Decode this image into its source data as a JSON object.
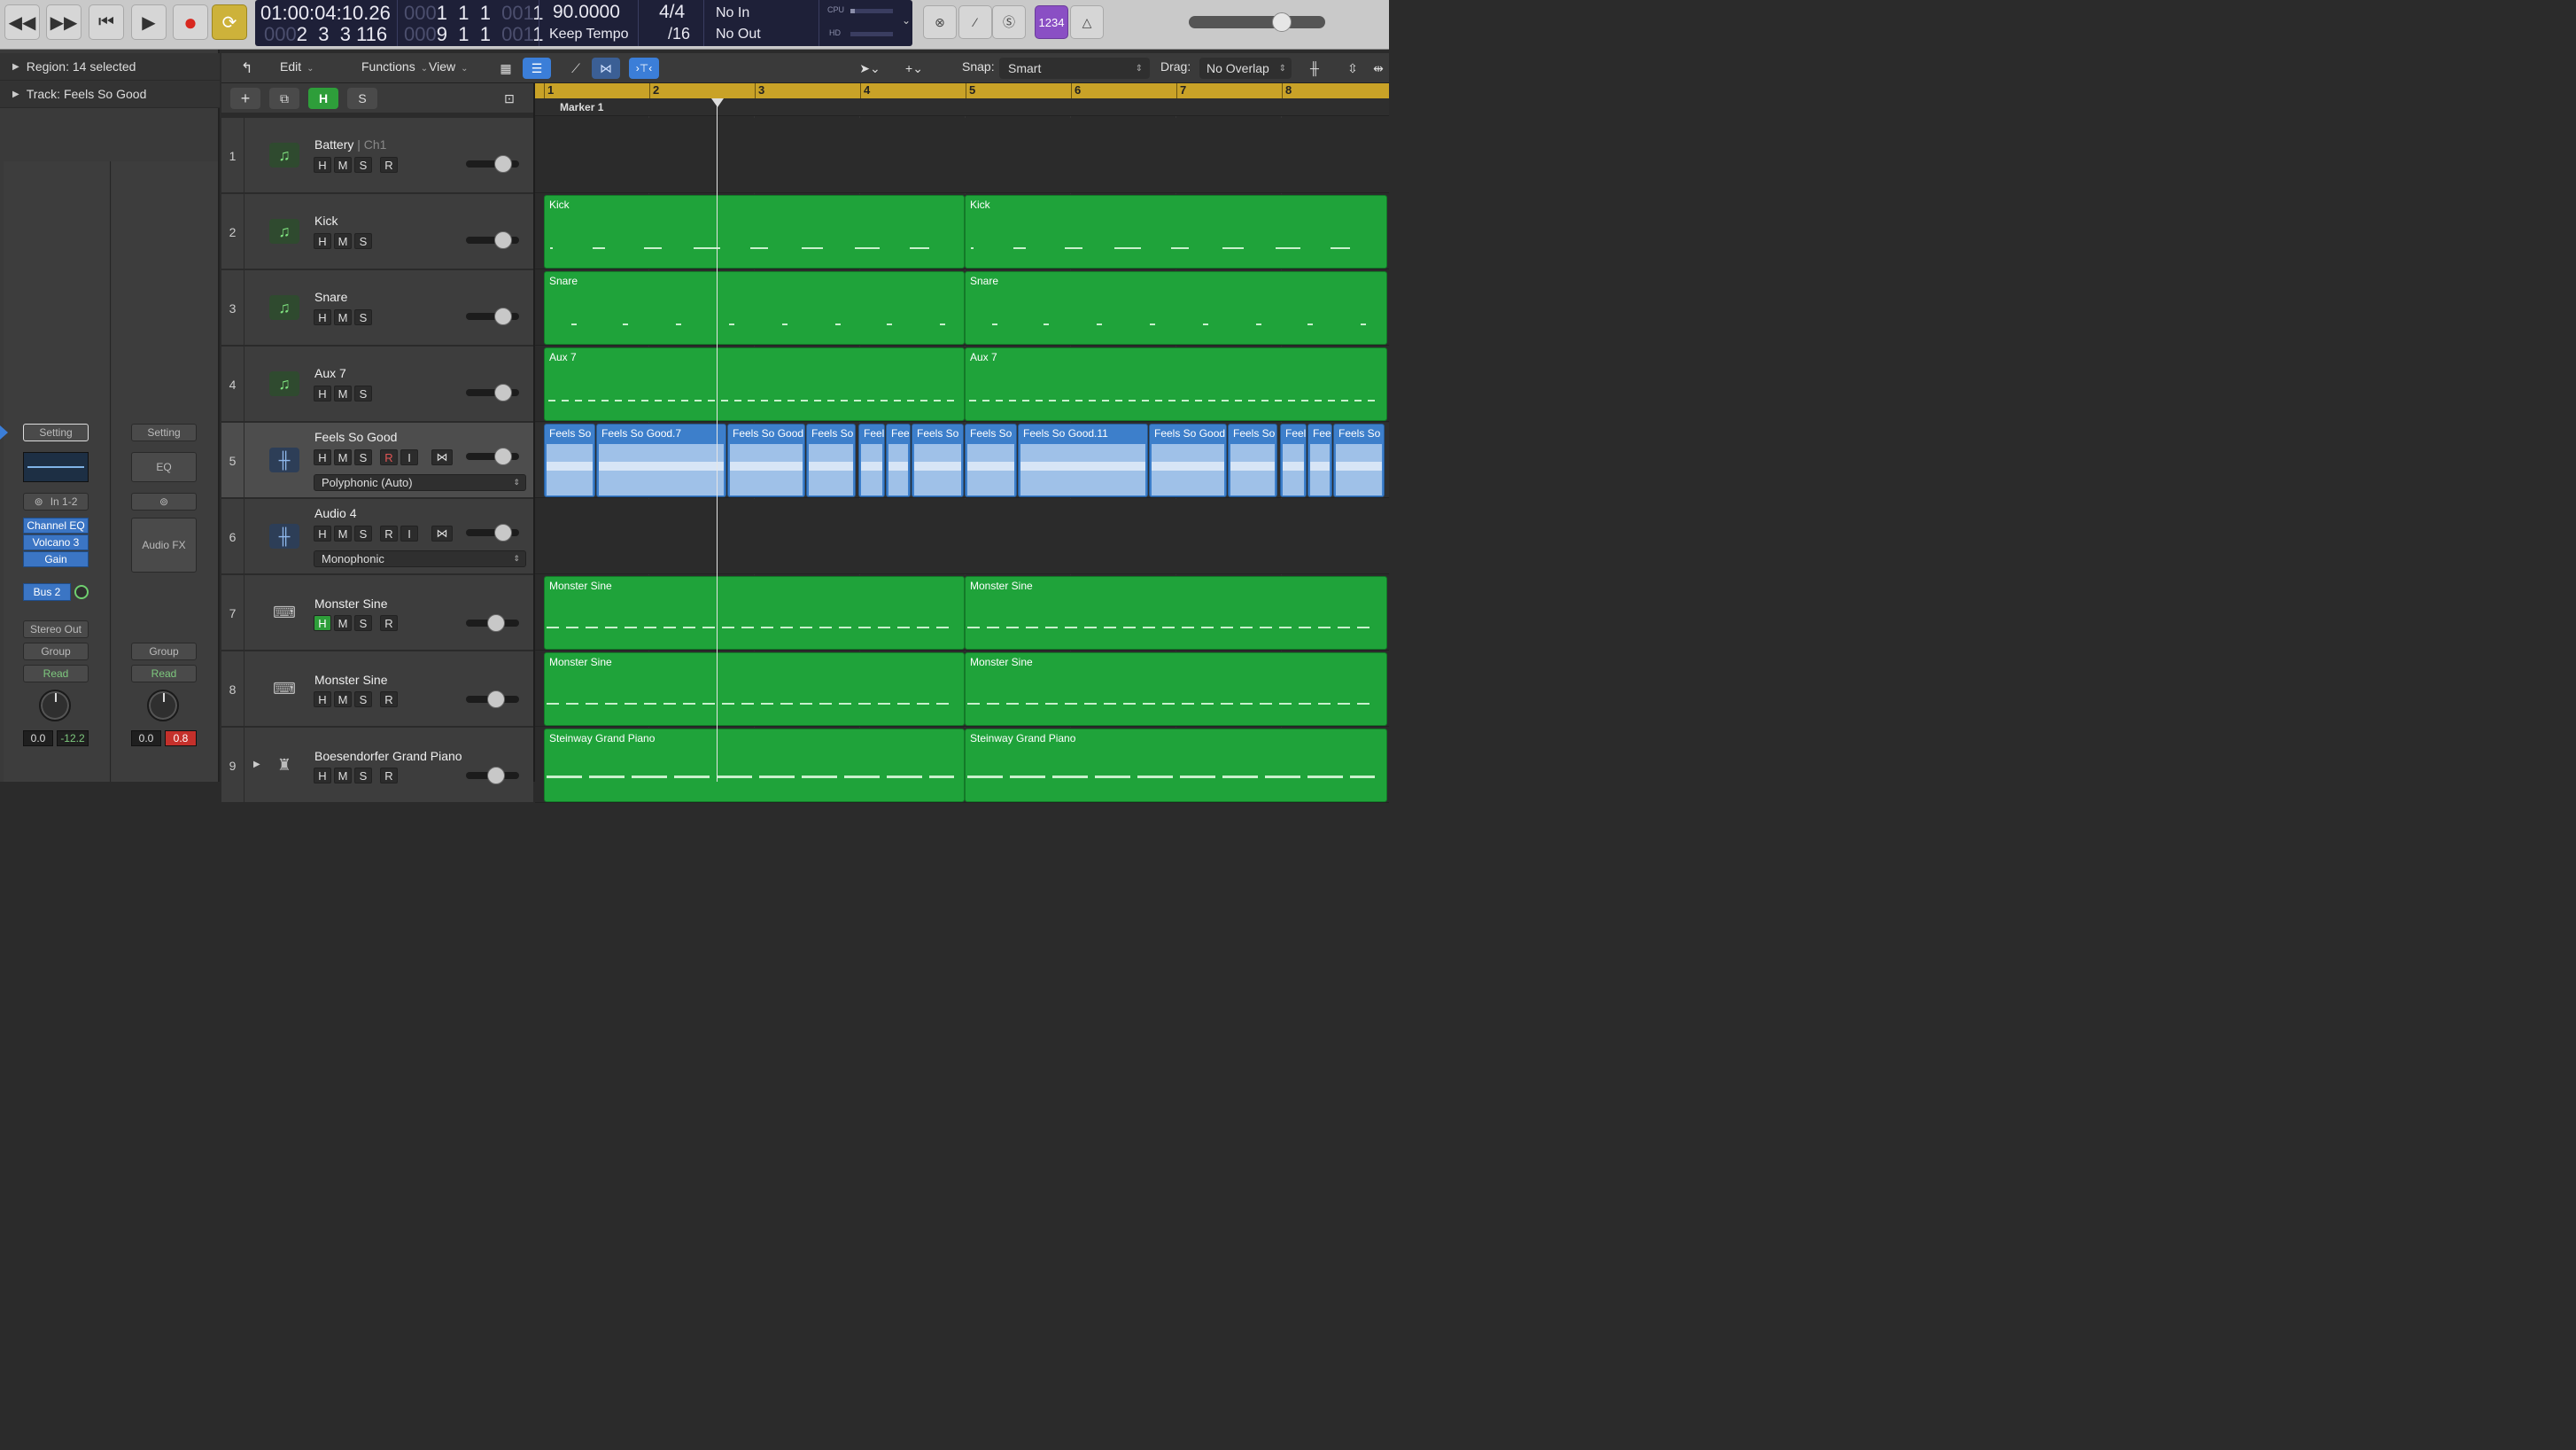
{
  "transport": {
    "icons": [
      "rewind-icon",
      "fast-forward-icon",
      "go-to-beginning-icon",
      "play-icon",
      "record-icon",
      "cycle-icon"
    ]
  },
  "lcd": {
    "time": "01:00:04:10.26",
    "bars_top": [
      "1",
      "1",
      "1",
      "1"
    ],
    "bars_top_dim": [
      "000",
      "001"
    ],
    "bars_bottom": [
      "2",
      "3",
      "3",
      "116"
    ],
    "bars_bottom_dim": "000",
    "position_b": [
      "9",
      "1",
      "1",
      "1"
    ],
    "position_b_dim": [
      "000",
      "001"
    ],
    "tempo": "90.0000",
    "tempo_mode": "Keep Tempo",
    "sig_top": "4/4",
    "sig_bottom": "/16",
    "in": "No In",
    "out": "No Out",
    "cpu": "CPU",
    "hd": "HD"
  },
  "right_controls": {
    "count_in": "1234"
  },
  "inspector": {
    "region": "Region:",
    "region_value": "14 selected",
    "track": "Track:",
    "track_value": "Feels So Good",
    "strip1": {
      "setting": "Setting",
      "input": "In 1-2",
      "plugins": [
        "Channel EQ",
        "Volcano 3",
        "Gain"
      ],
      "send": "Bus 2",
      "output": "Stereo Out",
      "group": "Group",
      "automation": "Read",
      "vol": "0.0",
      "peak": "-12.2"
    },
    "strip2": {
      "setting": "Setting",
      "eq": "EQ",
      "fx": "Audio FX",
      "group": "Group",
      "automation": "Read",
      "vol": "0.0",
      "peak": "0.8"
    }
  },
  "toolbar": {
    "edit": "Edit",
    "functions": "Functions",
    "view": "View",
    "snap_label": "Snap:",
    "snap_value": "Smart",
    "drag_label": "Drag:",
    "drag_value": "No Overlap"
  },
  "header_buttons": {
    "h": "H",
    "s": "S"
  },
  "ruler": {
    "bars": [
      "1",
      "2",
      "3",
      "4",
      "5",
      "6",
      "7",
      "8"
    ],
    "marker": "Marker 1"
  },
  "tracks": [
    {
      "num": "1",
      "name": "Battery",
      "ch": "Ch1",
      "buttons": [
        "H",
        "M",
        "S",
        "R"
      ]
    },
    {
      "num": "2",
      "name": "Kick",
      "buttons": [
        "H",
        "M",
        "S"
      ]
    },
    {
      "num": "3",
      "name": "Snare",
      "buttons": [
        "H",
        "M",
        "S"
      ]
    },
    {
      "num": "4",
      "name": "Aux 7",
      "buttons": [
        "H",
        "M",
        "S"
      ]
    },
    {
      "num": "5",
      "name": "Feels So Good",
      "buttons": [
        "H",
        "M",
        "S",
        "R",
        "I"
      ],
      "mode": "Polyphonic (Auto)"
    },
    {
      "num": "6",
      "name": "Audio 4",
      "buttons": [
        "H",
        "M",
        "S",
        "R",
        "I"
      ],
      "mode": "Monophonic"
    },
    {
      "num": "7",
      "name": "Monster Sine",
      "buttons": [
        "H",
        "M",
        "S",
        "R"
      ]
    },
    {
      "num": "8",
      "name": "Monster Sine",
      "buttons": [
        "H",
        "M",
        "S",
        "R"
      ]
    },
    {
      "num": "9",
      "name": "Boesendorfer Grand Piano",
      "buttons": [
        "H",
        "M",
        "S",
        "R"
      ]
    }
  ],
  "regions": {
    "kick": [
      "Kick",
      "Kick"
    ],
    "snare": [
      "Snare",
      "Snare"
    ],
    "aux": [
      "Aux 7",
      "Aux 7"
    ],
    "audio": [
      "Feels So",
      "Feels So Good.7",
      "Feels So Good",
      "Feels So",
      "Feel",
      "Fee",
      "Feels So",
      "Feels So",
      "Feels So Good.11",
      "Feels So Good",
      "Feels So",
      "Feel",
      "Fee",
      "Feels So"
    ],
    "sine7": [
      "Monster Sine",
      "Monster Sine"
    ],
    "sine8": [
      "Monster Sine",
      "Monster Sine"
    ],
    "piano": [
      "Steinway Grand Piano",
      "Steinway Grand Piano"
    ]
  },
  "colors": {
    "region_green": "#1fa33a",
    "region_blue": "#3d7fcb",
    "ruler": "#c9a227",
    "lcd": "#1e2038"
  }
}
